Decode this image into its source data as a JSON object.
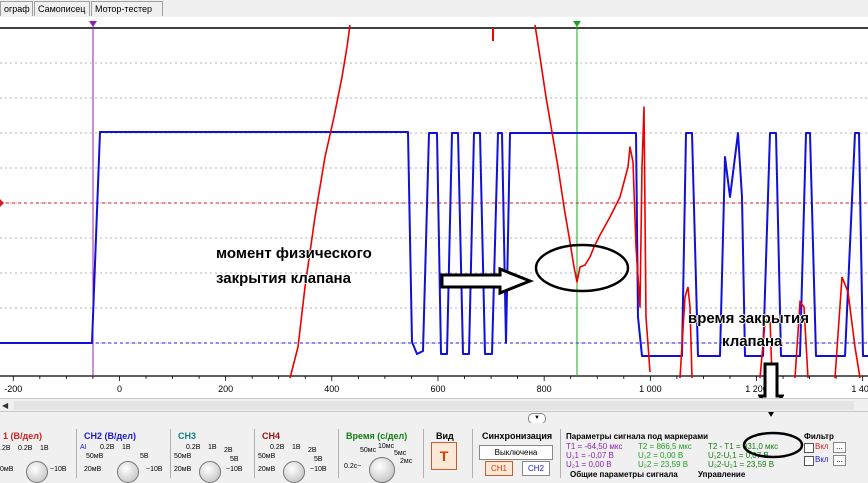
{
  "tabs": [
    "ограф",
    "Самописец",
    "Мотор-тестер"
  ],
  "chart_data": {
    "type": "line",
    "x_ticks": [
      "-200",
      "0",
      "200",
      "400",
      "600",
      "800",
      "1 000",
      "1 200",
      "1 400"
    ],
    "x_tick_values": [
      -200,
      0,
      200,
      400,
      600,
      800,
      1000,
      1200,
      1400
    ],
    "xlim": [
      -225,
      1410
    ],
    "series": [
      {
        "name": "CH1",
        "color": "#ee0000"
      },
      {
        "name": "CH2",
        "color": "#1010d8"
      }
    ],
    "markers": [
      {
        "name": "T1",
        "x": -64.5,
        "color": "#9020b0"
      },
      {
        "name": "T2",
        "x": 866.5,
        "color": "#20a020"
      }
    ]
  },
  "annotations": {
    "moment_line1": "момент физического",
    "moment_line2": "закрытия клапана",
    "time_line1": "время закрытия",
    "time_line2": "клапана"
  },
  "panel": {
    "ch1": {
      "title": "1 (В/дел)",
      "s1": ".2В",
      "s2": "0.2В",
      "s3": "1В",
      "s4": "0мВ",
      "s5": "~10В"
    },
    "ch2": {
      "title": "CH2 (В/дел)",
      "ai": "AI",
      "s1": "0.2В",
      "s2": "1В",
      "s3": "50мВ",
      "s4": "5В",
      "s5": "20мВ",
      "s6": "~10В"
    },
    "ch3": {
      "title": "CH3",
      "s1": "0.2В",
      "s2": "1В",
      "s3": "50мВ",
      "s4": "2В",
      "s5": "5В",
      "s6": "20мВ",
      "s7": "~10В"
    },
    "ch4": {
      "title": "CH4",
      "s1": "0.2В",
      "s2": "1В",
      "s3": "50мВ",
      "s4": "2В",
      "s5": "5В",
      "s6": "20мВ",
      "s7": "~10В"
    },
    "time": {
      "title": "Время (с/дел)",
      "s1": "10мс",
      "s2": "50мс",
      "s3": "5мс",
      "s4": "2мс",
      "s5": "0.2с~"
    },
    "view": {
      "title": "Вид",
      "btn": "T"
    },
    "sync": {
      "title": "Синхронизация",
      "off": "Выключена",
      "ch1": "CH1",
      "ch2": "CH2"
    },
    "params": {
      "title": "Параметры сигнала под маркерами",
      "t1": "T1 = -64,50 мкс",
      "t2": "T2 = 866,5 мкс",
      "dt": "T2 - T1 = 931,0 мкс",
      "u11": "U₁1 = -0,07 В",
      "u21": "U₂1 = 0,00 В",
      "u12": "U₁2 = 0,00 В",
      "u22": "U₂2 = 23,59 В",
      "du1": "U₁2-U₁1 = 0,07 В",
      "du2": "U₂2-U₂1 = 23,59 В",
      "bottom1": "Общие параметры сигнала",
      "bottom2": "Управление"
    },
    "filter": {
      "title": "Фильтр",
      "on1": "Вкл",
      "on2": "Вкл",
      "dots": "..."
    }
  },
  "colors": {
    "ch1": "#ee0000",
    "ch2": "#1010d8",
    "marker_t1": "#9020b0",
    "marker_t2": "#20a020",
    "accent": "#d44000"
  }
}
